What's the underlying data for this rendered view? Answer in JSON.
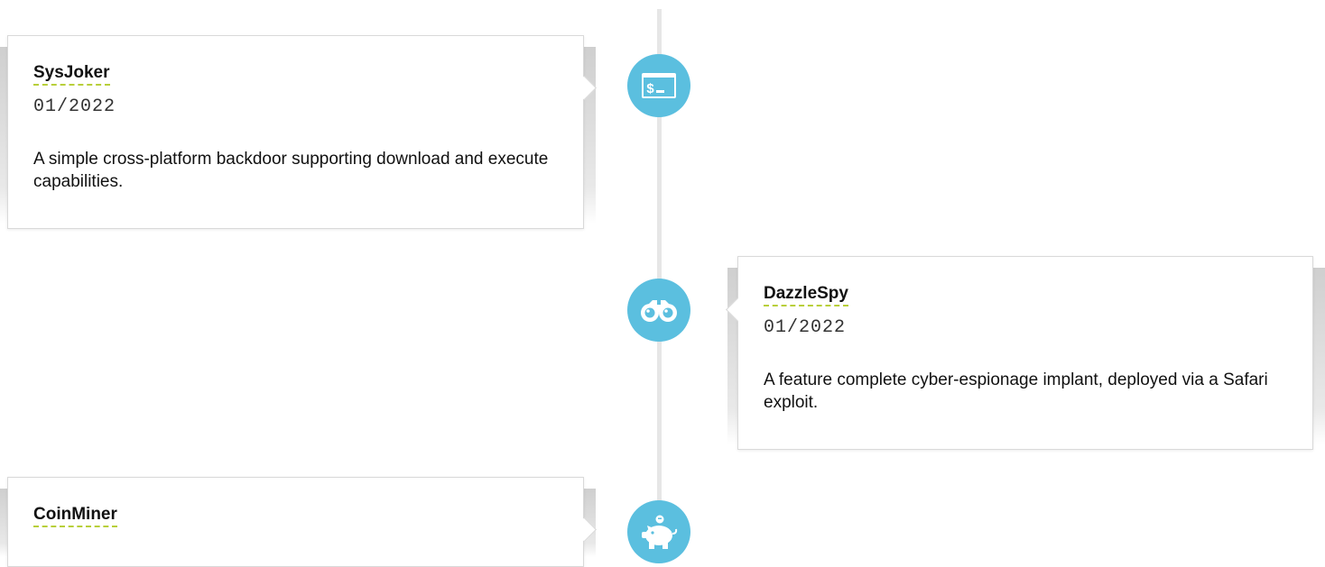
{
  "entries": [
    {
      "title": "SysJoker",
      "date": "01/2022",
      "description": "A simple cross-platform backdoor supporting download and execute capabilities.",
      "icon": "terminal-icon"
    },
    {
      "title": "DazzleSpy",
      "date": "01/2022",
      "description": "A feature complete cyber-espionage implant, deployed via a Safari exploit.",
      "icon": "binoculars-icon"
    },
    {
      "title": "CoinMiner",
      "icon": "piggy-bank-icon"
    }
  ],
  "colors": {
    "node": "#5bbfdf",
    "title_underline": "#b8cf3a",
    "timeline": "#e6e6e6"
  }
}
